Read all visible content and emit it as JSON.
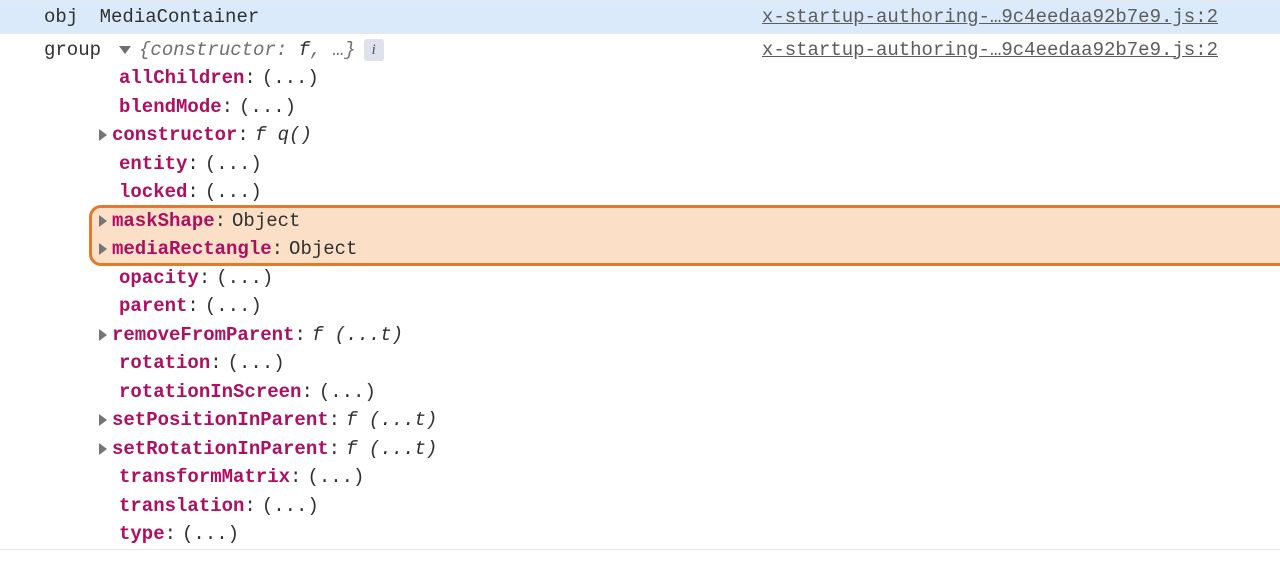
{
  "rows": [
    {
      "badge": "obj",
      "title": "MediaContainer",
      "source": "x-startup-authoring-…9c4eedaa92b7e9.js:2"
    },
    {
      "badge": "group",
      "summary_prefix": "{",
      "summary_key": "constructor",
      "summary_sep": ": ",
      "summary_f": "f",
      "summary_rest": ", …}",
      "info": "i",
      "source": "x-startup-authoring-…9c4eedaa92b7e9.js:2"
    }
  ],
  "props": [
    {
      "key": "allChildren",
      "kind": "ellipsis"
    },
    {
      "key": "blendMode",
      "kind": "ellipsis"
    },
    {
      "key": "constructor",
      "kind": "fn",
      "fnName": "q()",
      "expandable": true
    },
    {
      "key": "entity",
      "kind": "ellipsis"
    },
    {
      "key": "locked",
      "kind": "ellipsis"
    },
    {
      "key": "maskShape",
      "kind": "object",
      "expandable": true,
      "highlighted": true
    },
    {
      "key": "mediaRectangle",
      "kind": "object",
      "expandable": true,
      "highlighted": true
    },
    {
      "key": "opacity",
      "kind": "ellipsis"
    },
    {
      "key": "parent",
      "kind": "ellipsis"
    },
    {
      "key": "removeFromParent",
      "kind": "fn",
      "fnName": "(...t)",
      "expandable": true
    },
    {
      "key": "rotation",
      "kind": "ellipsis"
    },
    {
      "key": "rotationInScreen",
      "kind": "ellipsis"
    },
    {
      "key": "setPositionInParent",
      "kind": "fn",
      "fnName": "(...t)",
      "expandable": true
    },
    {
      "key": "setRotationInParent",
      "kind": "fn",
      "fnName": "(...t)",
      "expandable": true
    },
    {
      "key": "transformMatrix",
      "kind": "ellipsis"
    },
    {
      "key": "translation",
      "kind": "ellipsis"
    },
    {
      "key": "type",
      "kind": "ellipsis"
    }
  ],
  "labels": {
    "ellipsis": "(...)",
    "object": "Object",
    "f": "f"
  }
}
